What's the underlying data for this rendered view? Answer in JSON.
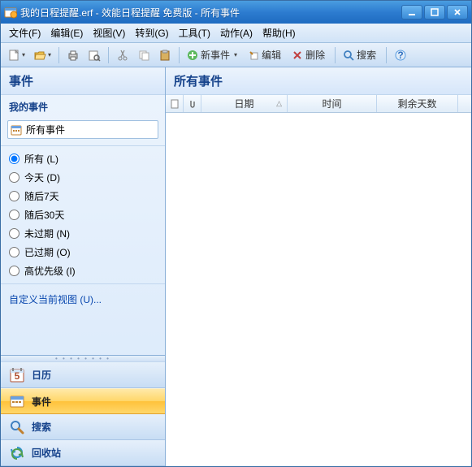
{
  "window": {
    "title": "我的日程提醒.erf - 效能日程提醒 免费版 - 所有事件"
  },
  "menus": {
    "file": "文件(F)",
    "edit": "编辑(E)",
    "view": "视图(V)",
    "goto": "转到(G)",
    "tool": "工具(T)",
    "action": "动作(A)",
    "help": "帮助(H)"
  },
  "toolbar": {
    "new_event": "新事件",
    "edit": "编辑",
    "delete": "删除",
    "search": "搜索"
  },
  "sidebar": {
    "header": "事件",
    "sub": "我的事件",
    "tree_item": "所有事件",
    "radios": {
      "all": "所有 (L)",
      "today": "今天 (D)",
      "next7": "随后7天",
      "next30": "随后30天",
      "not_due": "未过期 (N)",
      "overdue": "已过期 (O)",
      "high_priority": "高优先级 (I)"
    },
    "custom_view": "自定义当前视图 (U)...",
    "nav": {
      "calendar": "日历",
      "events": "事件",
      "search": "搜索",
      "recycle": "回收站"
    }
  },
  "main": {
    "header": "所有事件",
    "columns": {
      "date": "日期",
      "time": "时间",
      "days_left": "剩余天数"
    }
  }
}
